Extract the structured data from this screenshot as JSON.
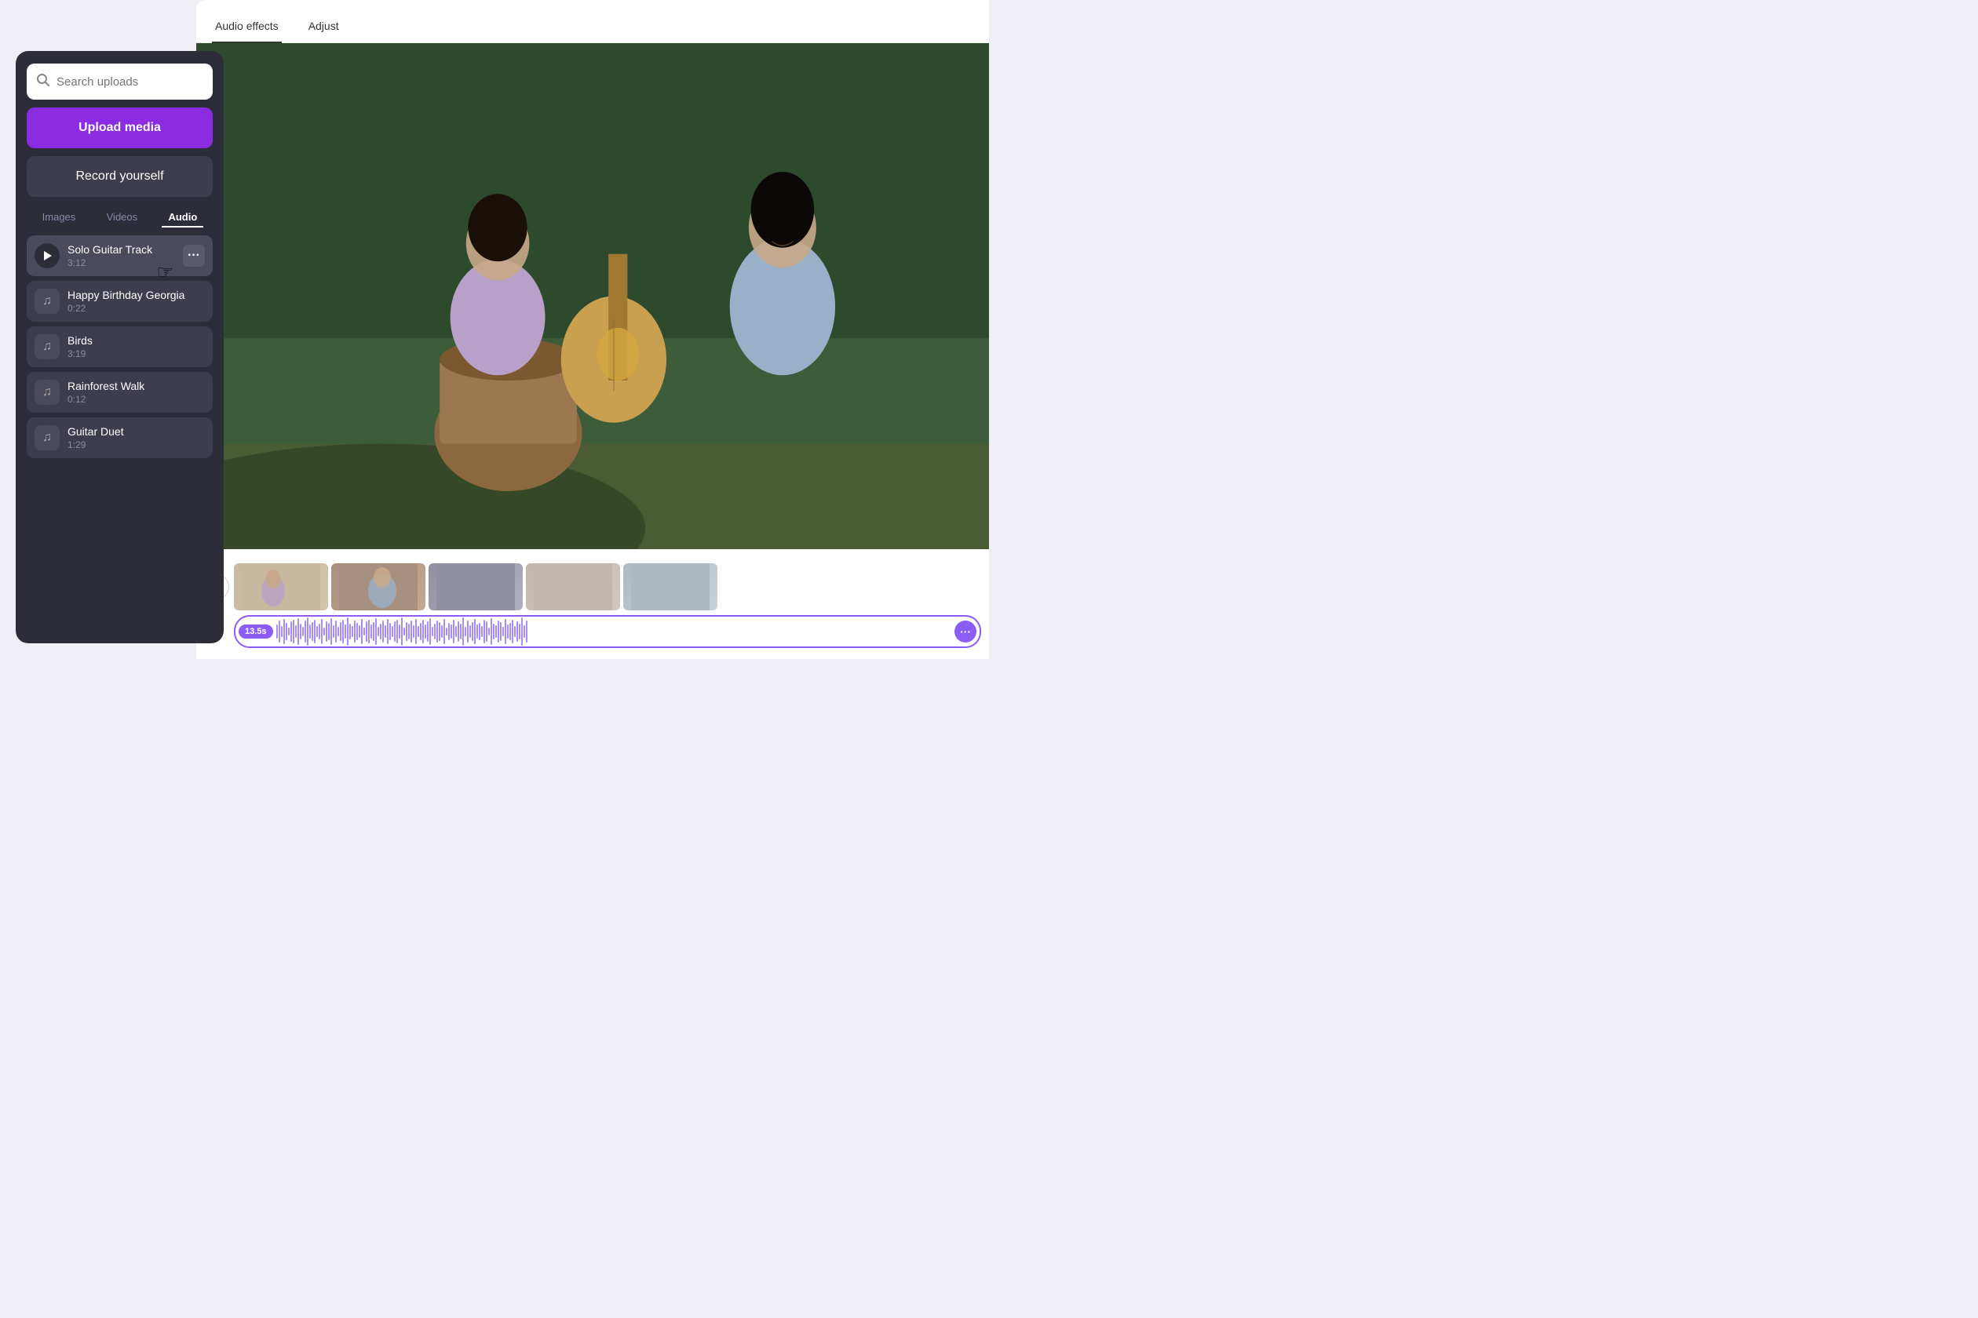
{
  "sidebar": {
    "search_placeholder": "Search uploads",
    "upload_label": "Upload media",
    "record_label": "Record yourself",
    "tabs": [
      {
        "id": "images",
        "label": "Images",
        "active": false
      },
      {
        "id": "videos",
        "label": "Videos",
        "active": false
      },
      {
        "id": "audio",
        "label": "Audio",
        "active": true
      }
    ],
    "audio_items": [
      {
        "id": "1",
        "name": "Solo Guitar Track",
        "duration": "3:12",
        "playing": true
      },
      {
        "id": "2",
        "name": "Happy Birthday Georgia",
        "duration": "0:22",
        "playing": false
      },
      {
        "id": "3",
        "name": "Birds",
        "duration": "3:19",
        "playing": false
      },
      {
        "id": "4",
        "name": "Rainforest Walk",
        "duration": "0:12",
        "playing": false
      },
      {
        "id": "5",
        "name": "Guitar Duet",
        "duration": "1:29",
        "playing": false
      }
    ]
  },
  "editor": {
    "tabs": [
      {
        "id": "audio-effects",
        "label": "Audio effects",
        "active": true
      },
      {
        "id": "adjust",
        "label": "Adjust",
        "active": false
      }
    ],
    "timeline": {
      "timestamp_label": "13.5s",
      "more_label": "···"
    }
  },
  "icons": {
    "search": "🔍",
    "music_note": "♫",
    "play": "▶",
    "more_dots": "···"
  }
}
